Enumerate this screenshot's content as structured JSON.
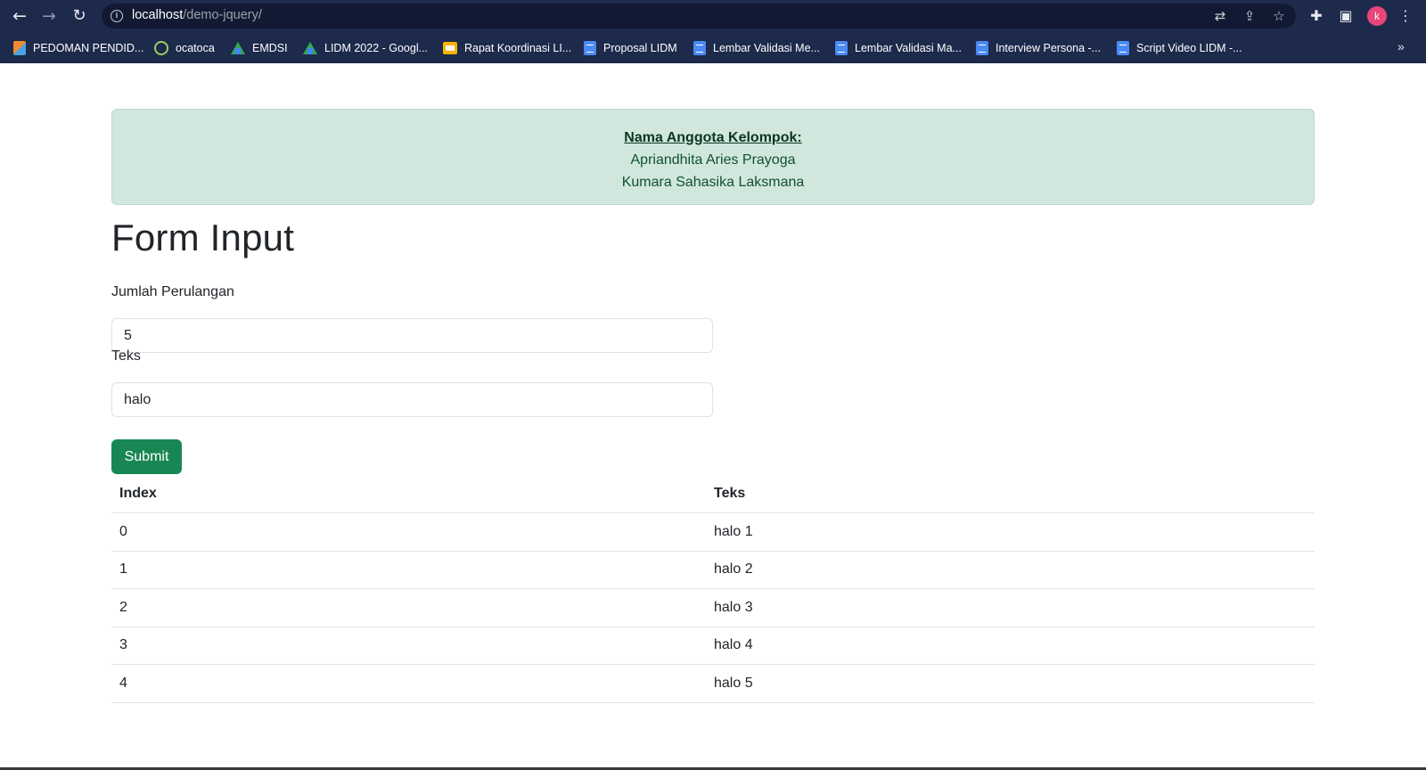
{
  "browser": {
    "url_host": "localhost",
    "url_path": "/demo-jquery/",
    "avatar_letter": "k",
    "bookmarks": [
      {
        "label": "PEDOMAN PENDID...",
        "icon": "book-icon"
      },
      {
        "label": "ocatoca",
        "icon": "circle-icon"
      },
      {
        "label": "EMDSI",
        "icon": "drive-icon"
      },
      {
        "label": "LIDM 2022 - Googl...",
        "icon": "drive-icon"
      },
      {
        "label": "Rapat Koordinasi LI...",
        "icon": "slides-icon"
      },
      {
        "label": "Proposal LIDM",
        "icon": "doc-icon"
      },
      {
        "label": "Lembar Validasi Me...",
        "icon": "doc-icon"
      },
      {
        "label": "Lembar Validasi Ma...",
        "icon": "doc-icon"
      },
      {
        "label": "Interview Persona -...",
        "icon": "doc-icon"
      },
      {
        "label": "Script Video LIDM -...",
        "icon": "doc-icon"
      }
    ],
    "more_bookmarks": "»"
  },
  "alert": {
    "title": "Nama Anggota Kelompok:",
    "members": [
      "Apriandhita Aries Prayoga",
      "Kumara Sahasika Laksmana"
    ]
  },
  "form": {
    "heading": "Form Input",
    "jumlah_label": "Jumlah Perulangan",
    "jumlah_value": "5",
    "teks_label": "Teks",
    "teks_value": "halo",
    "submit_label": "Submit"
  },
  "table": {
    "headers": [
      "Index",
      "Teks"
    ],
    "rows": [
      [
        "0",
        "halo 1"
      ],
      [
        "1",
        "halo 2"
      ],
      [
        "2",
        "halo 3"
      ],
      [
        "3",
        "halo 4"
      ],
      [
        "4",
        "halo 5"
      ]
    ]
  },
  "colors": {
    "browser_bar": "#1d2a4b",
    "alert_bg": "#d1e7dd",
    "submit_bg": "#198754",
    "avatar_bg": "#e8457a"
  }
}
